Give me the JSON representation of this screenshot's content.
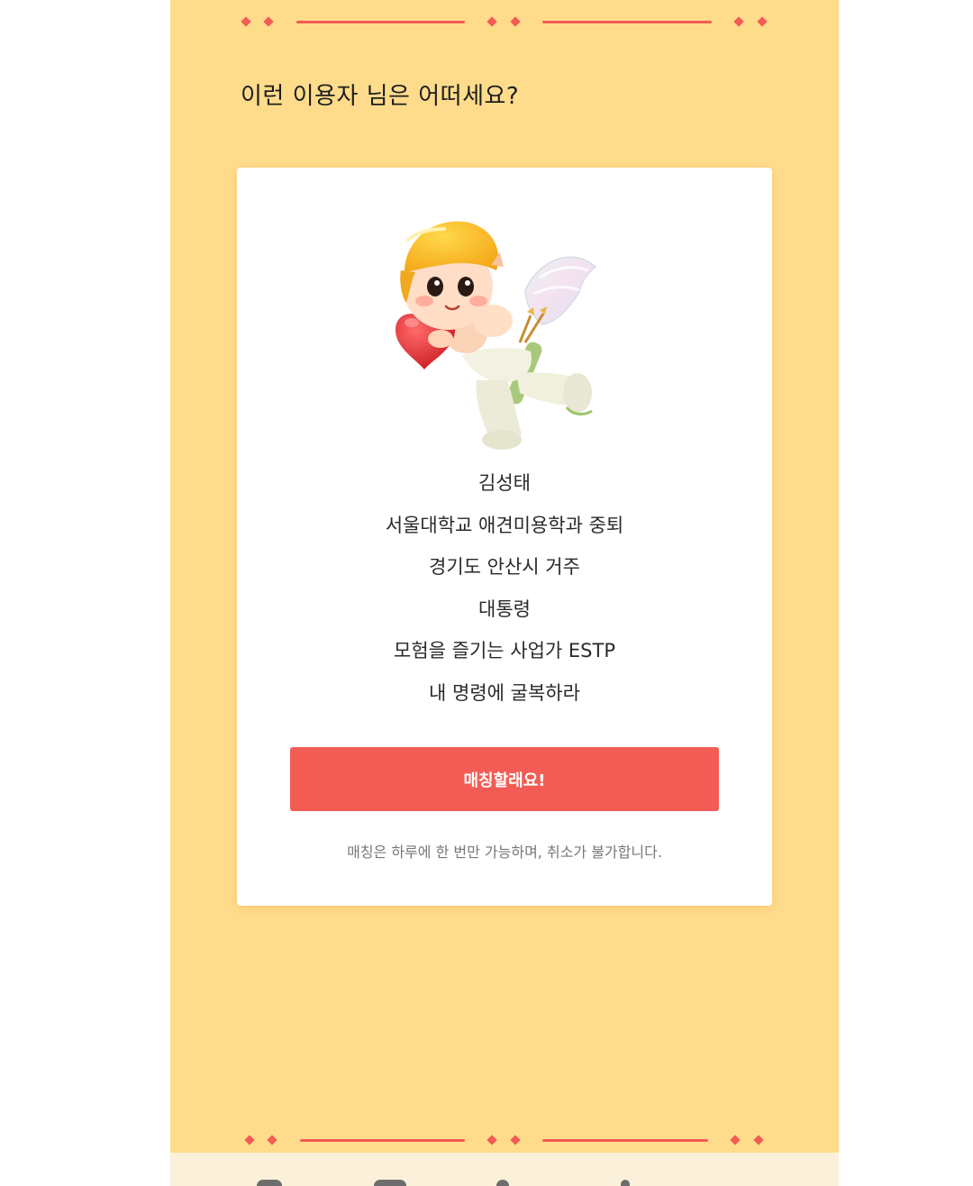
{
  "header": {
    "title": "이런 이용자 님은 어떠세요?"
  },
  "profile": {
    "name": "김성태",
    "school": "서울대학교 애견미용학과 중퇴",
    "location": "경기도 안산시 거주",
    "job": "대통령",
    "mbti": "모험을 즐기는 사업가 ESTP",
    "motto": "내 명령에 굴복하라"
  },
  "actions": {
    "match_label": "매칭할래요!",
    "notice": "매칭은 하루에 한 번만 가능하며, 취소가 불가합니다."
  },
  "colors": {
    "background": "#ffdc8c",
    "accent": "#f25c54",
    "card": "#ffffff",
    "bottom_bar": "#fbf0d9"
  }
}
